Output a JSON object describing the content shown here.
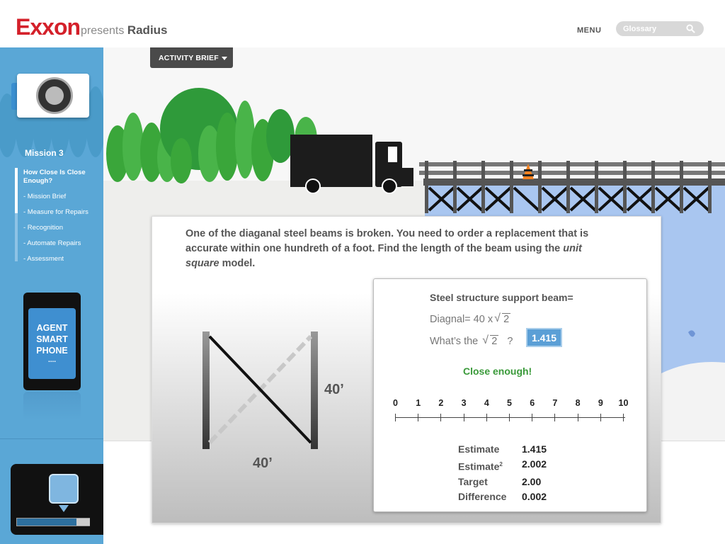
{
  "header": {
    "logo": "ExxonMobil",
    "logo_display": "Exxon",
    "presents": "presents",
    "product": "Radius",
    "menu_label": "MENU",
    "search_placeholder": "Glossary"
  },
  "sidebar": {
    "mission_title": "Mission 3",
    "nav": [
      {
        "label": "How Close Is Close Enough?",
        "active": true
      },
      {
        "label": "- Mission Brief"
      },
      {
        "label": "- Measure for Repairs"
      },
      {
        "label": "- Recognition"
      },
      {
        "label": "- Automate Repairs"
      },
      {
        "label": "- Assessment"
      }
    ],
    "phone": {
      "line1": "AGENT",
      "line2": "SMART",
      "line3": "PHONE",
      "dots": "...."
    }
  },
  "activity_brief": "ACTIVITY BRIEF",
  "problem": {
    "text_before": "One of the diaganal steel beams is broken. You need to order a replacement that is accurate within one hundreth of a foot. Find the length of the beam using the ",
    "text_italic": "unit square",
    "text_after": " model."
  },
  "diagram": {
    "side_label": "40’",
    "bottom_label": "40’"
  },
  "answer": {
    "title": "Steel structure support beam=",
    "diag_prefix": "Diagnal= 40 x",
    "radicand": "2",
    "question_prefix": "What’s the",
    "question_suffix": "?",
    "input_value": "1.415",
    "feedback": "Close enough!"
  },
  "ruler": {
    "labels": [
      "0",
      "1",
      "2",
      "3",
      "4",
      "5",
      "6",
      "7",
      "8",
      "9",
      "10"
    ]
  },
  "stats": {
    "estimate_label": "Estimate",
    "estimate_value": "1.415",
    "estimate_sq_label": "Estimate",
    "estimate_sq_sup": "2",
    "estimate_sq_value": "2.002",
    "target_label": "Target",
    "target_value": "2.00",
    "difference_label": "Difference",
    "difference_value": "0.002"
  },
  "colors": {
    "brand_red": "#d4202a",
    "sidebar_blue": "#5aa7d6",
    "success_green": "#3a9a3a",
    "input_blue": "#5b9fd6"
  }
}
